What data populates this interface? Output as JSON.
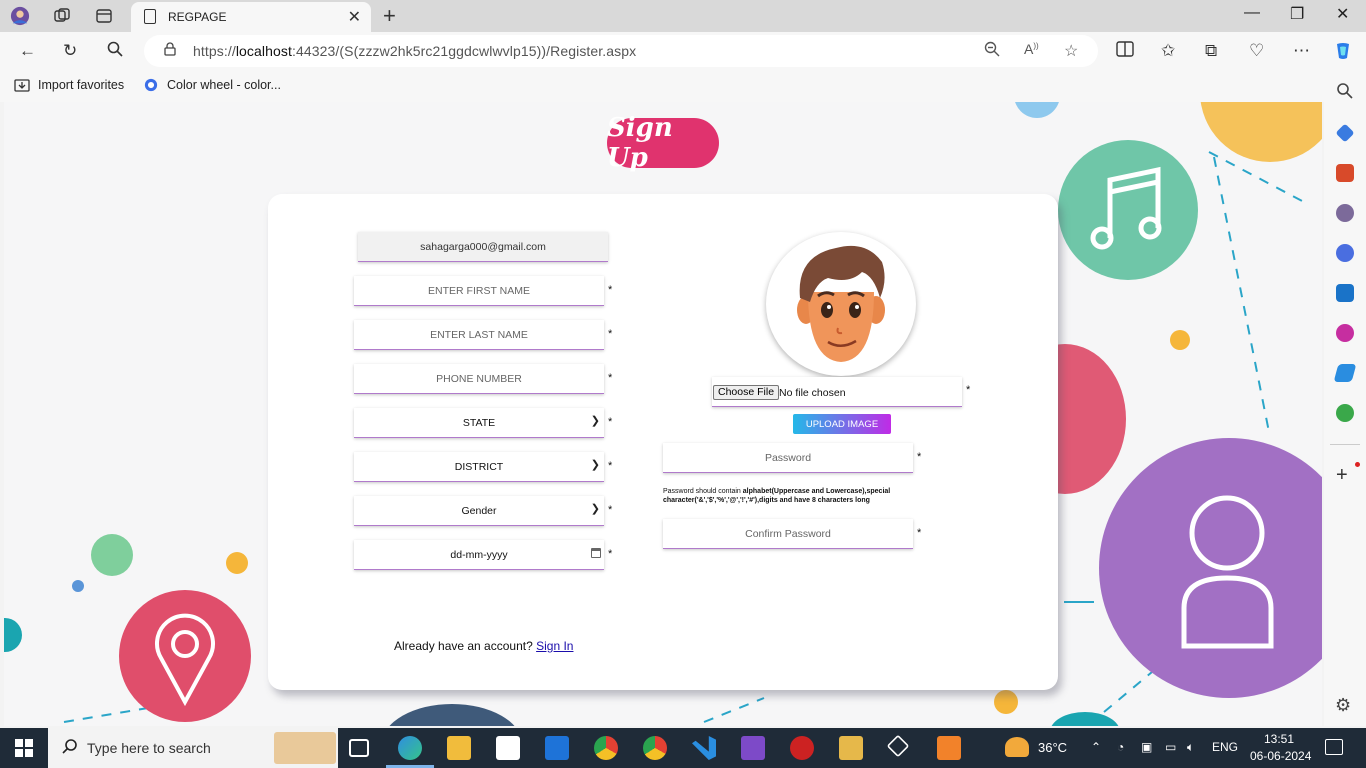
{
  "browser": {
    "tab_title": "REGPAGE",
    "url_prefix": "https://",
    "url_host": "localhost",
    "url_rest": ":44323/(S(zzzw2hk5rc21ggdcwlwvlp15))/Register.aspx",
    "favorites": [
      {
        "label": "Import favorites",
        "icon": "import-icon"
      },
      {
        "label": "Color wheel - color...",
        "icon": "color-wheel-icon"
      }
    ]
  },
  "page": {
    "badge": "Sign Up",
    "form": {
      "email_value": "sahagarga000@gmail.com",
      "first_name_placeholder": "ENTER FIRST NAME",
      "last_name_placeholder": "ENTER LAST NAME",
      "phone_placeholder": "PHONE NUMBER",
      "state_value": "STATE",
      "district_value": "DISTRICT",
      "gender_value": "Gender",
      "dob_placeholder": "dd-mm-yyyy",
      "required_mark": "*",
      "choose_file": "Choose File",
      "no_file": "No file chosen",
      "upload_label": "UPLOAD IMAGE",
      "password_placeholder": "Password",
      "password_hint_prefix": "Password should contain ",
      "password_hint_bold": "alphabet(Uppercase and Lowercase),special character('&','$','%','@','!','#'),digits and have 8 characters long",
      "confirm_password_placeholder": "Confirm Password"
    },
    "signin_text": "Already have an account? ",
    "signin_link": "Sign In"
  },
  "taskbar": {
    "search_placeholder": "Type here to search",
    "weather": "36°C",
    "language": "ENG",
    "time": "13:51",
    "date": "06-06-2024"
  },
  "colors": {
    "badge": "#e0336e",
    "field_underline": "#b07acb",
    "upload_gradient_start": "#24b8e8",
    "upload_gradient_end": "#c02be6"
  }
}
